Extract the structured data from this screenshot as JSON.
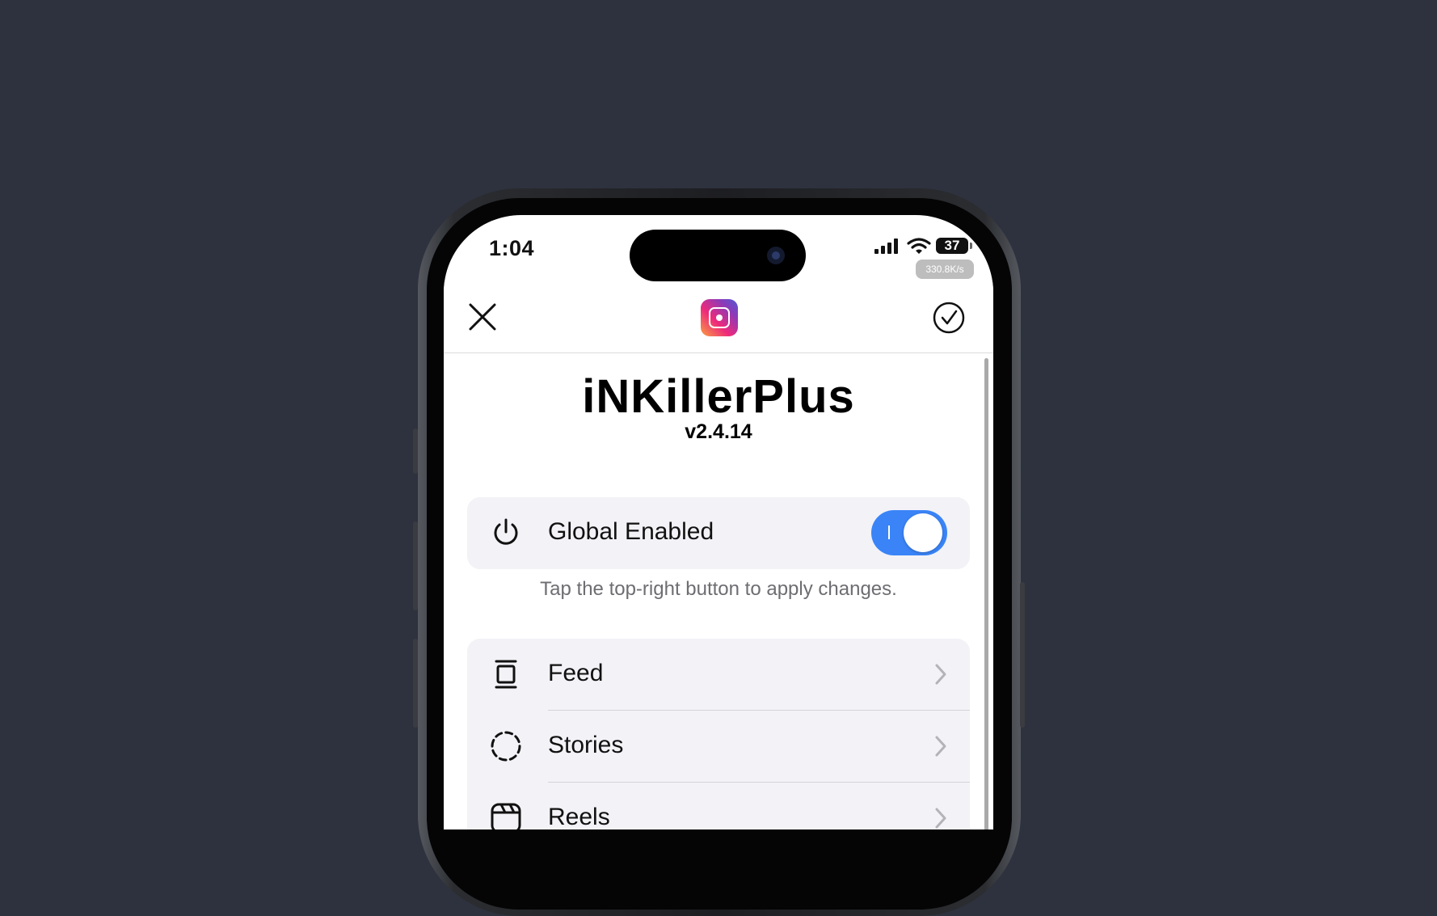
{
  "status_bar": {
    "time": "1:04",
    "battery": "37",
    "net_speed": "330.8K/s"
  },
  "nav": {
    "close_icon": "close-icon",
    "logo_icon": "instagram-logo-icon",
    "confirm_icon": "check-circle-icon"
  },
  "header": {
    "title": "iNKillerPlus",
    "version": "v2.4.14"
  },
  "global": {
    "label": "Global Enabled",
    "icon": "power-icon",
    "enabled": true,
    "hint": "Tap the top-right button to apply changes."
  },
  "menu": {
    "items": [
      {
        "label": "Feed",
        "icon": "feed-icon"
      },
      {
        "label": "Stories",
        "icon": "stories-icon"
      },
      {
        "label": "Reels",
        "icon": "reels-icon"
      }
    ]
  },
  "colors": {
    "background": "#2e323e",
    "accent": "#3a84f7",
    "card": "#f2f2f7"
  }
}
